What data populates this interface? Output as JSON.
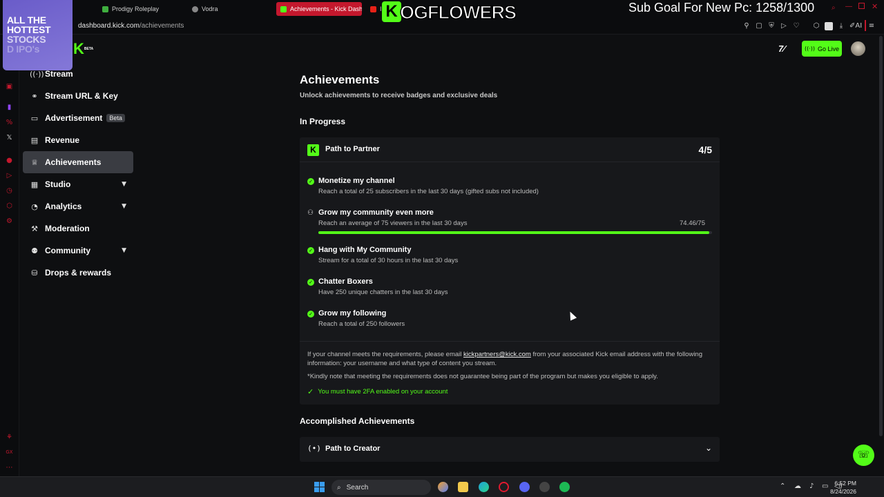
{
  "browser": {
    "tabs": [
      {
        "label": "Prodigy Roleplay",
        "active": false
      },
      {
        "label": "Vodra",
        "active": false
      },
      {
        "label": "Achievements - Kick Dashb",
        "active": true
      },
      {
        "label": "In",
        "active": false
      }
    ],
    "address_host": "dashboard.kick.com",
    "address_path": "/achievements"
  },
  "overlays": {
    "stocks_lines": [
      "ALL THE",
      "HOTTEST",
      "STOCKS",
      "D IPO's"
    ],
    "ogflowers_k": "K",
    "ogflowers_text": "OGFLOWERS",
    "sub_goal": "Sub Goal For New Pc: 1258/1300"
  },
  "sidebar": {
    "logo_letter": "K",
    "logo_beta": "BETA",
    "items": [
      {
        "label": "Stream",
        "icon": "stream-icon",
        "expandable": false,
        "active": false
      },
      {
        "label": "Stream URL & Key",
        "icon": "link-icon",
        "expandable": false,
        "active": false
      },
      {
        "label": "Advertisement",
        "icon": "ad-icon",
        "badge": "Beta",
        "expandable": false,
        "active": false
      },
      {
        "label": "Revenue",
        "icon": "revenue-icon",
        "expandable": false,
        "active": false
      },
      {
        "label": "Achievements",
        "icon": "trophy-icon",
        "expandable": false,
        "active": true
      },
      {
        "label": "Studio",
        "icon": "studio-icon",
        "expandable": true,
        "active": false
      },
      {
        "label": "Analytics",
        "icon": "analytics-icon",
        "expandable": true,
        "active": false
      },
      {
        "label": "Moderation",
        "icon": "wrench-icon",
        "expandable": false,
        "active": false
      },
      {
        "label": "Community",
        "icon": "community-icon",
        "expandable": true,
        "active": false
      },
      {
        "label": "Drops & rewards",
        "icon": "drops-icon",
        "expandable": false,
        "active": false
      }
    ]
  },
  "header": {
    "go_live_label": "Go Live"
  },
  "main": {
    "title": "Achievements",
    "subtitle": "Unlock achievements to receive badges and exclusive deals",
    "in_progress_heading": "In Progress",
    "partner_card": {
      "title": "Path to Partner",
      "count": "4/5",
      "requirements": [
        {
          "title": "Monetize my channel",
          "desc": "Reach a total of 25 subscribers in the last 30 days (gifted subs not included)",
          "done": true
        },
        {
          "title": "Grow my community even more",
          "desc": "Reach an average of 75 viewers in the last 30 days",
          "done": false,
          "value": "74.46/75",
          "progress": 0.9928
        },
        {
          "title": "Hang with My Community",
          "desc": "Stream for a total of 30 hours in the last 30 days",
          "done": true
        },
        {
          "title": "Chatter Boxers",
          "desc": "Have 250 unique chatters in the last 30 days",
          "done": true
        },
        {
          "title": "Grow my following",
          "desc": "Reach a total of 250 followers",
          "done": true
        }
      ],
      "info_before": "If your channel meets the requirements, please email ",
      "info_email": "kickpartners@kick.com",
      "info_after": " from your associated Kick email address with the following information: your username and what type of content you stream.",
      "note": "*Kindly note that meeting the requirements does not guarantee being part of the program but makes you eligible to apply.",
      "twofa": "You must have 2FA enabled on your account"
    },
    "accomplished_heading": "Accomplished Achievements",
    "creator_card": {
      "icon": "(•)",
      "title": "Path to Creator"
    }
  },
  "taskbar": {
    "search_label": "Search",
    "time": "6:52 PM",
    "date": "8/24/2026"
  },
  "colors": {
    "accent": "#53fc18",
    "background": "#0e0f11",
    "card": "#17181b"
  }
}
